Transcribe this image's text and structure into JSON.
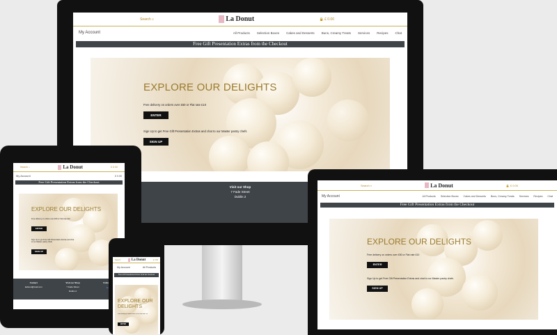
{
  "site": {
    "search_label": "Search",
    "brand_name": "La Donut",
    "cart_label": "£ 0.00",
    "account_label": "My Account",
    "nav_links": [
      "All Products",
      "Selection Boxes",
      "Cakes and Desserts",
      "Buns, Creamy Treats",
      "Services",
      "Recipes",
      "Chat"
    ],
    "promo_banner": "Free Gift Presentation Extras from the Checkout",
    "hero_heading": "EXPLORE OUR DELIGHTS",
    "hero_delivery": "Free delivery on orders over £50 or Flat rate £10",
    "enter_button": "ENTER",
    "signup_text": "Sign Up to get Free Gift Presentation Extras and chat to our Master pastry chefs",
    "signup_button": "SIGN UP",
    "footer_visit_title": "Visit our Shop",
    "footer_street": "7 Fade Street",
    "footer_city": "Dublin 2",
    "footer_contact": "Contact",
    "footer_email": "ladonut@mail.com",
    "footer_follow": "Follow us"
  },
  "colors": {
    "accent": "#9a7a2c",
    "banner": "#3f4448",
    "button": "#111111"
  }
}
